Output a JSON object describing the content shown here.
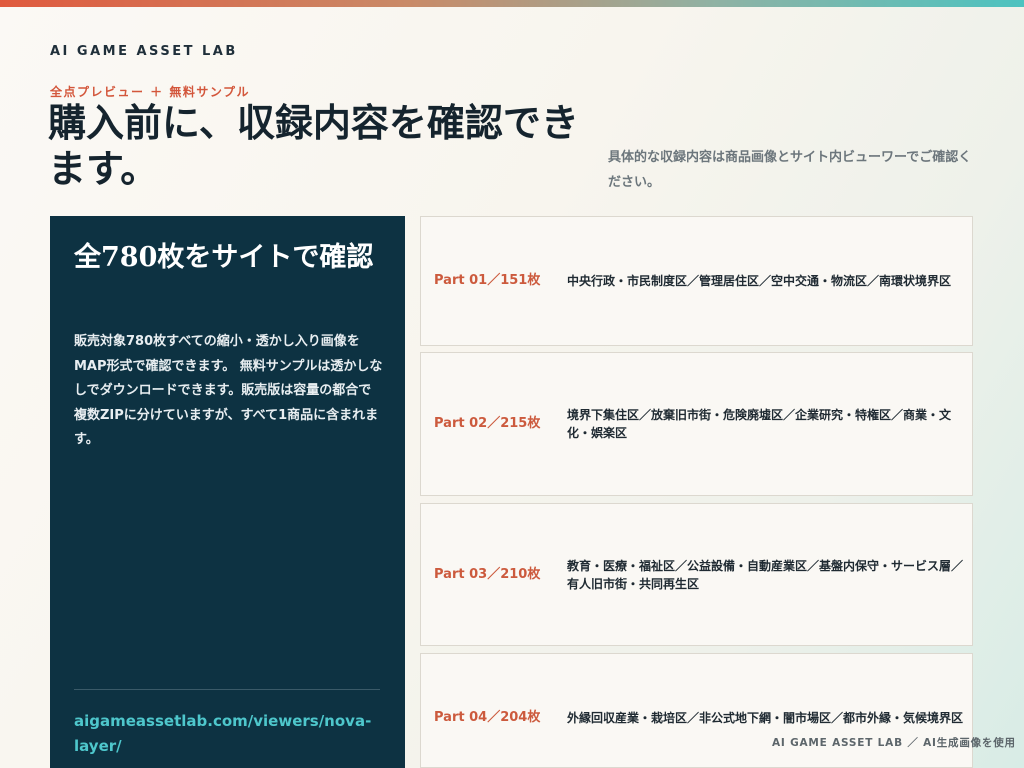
{
  "brand": "AI GAME ASSET LAB",
  "eyebrow": "全点プレビュー ＋ 無料サンプル",
  "headline": "購入前に、収録内容を確認できます。",
  "lead": "具体的な収録内容は商品画像とサイト内ビューワーでご確認ください。",
  "panel": {
    "title": "全780枚をサイトで確認",
    "body": "販売対象780枚すべての縮小・透かし入り画像をMAP形式で確認できます。 無料サンプルは透かしなしでダウンロードできます。販売版は容量の都合で複数ZIPに分けていますが、すべて1商品に含まれます。",
    "link": "aigameassetlab.com/viewers/nova-layer/"
  },
  "parts": [
    {
      "label": "Part 01／151枚",
      "desc": "中央行政・市民制度区／管理居住区／空中交通・物流区／南環状境界区"
    },
    {
      "label": "Part 02／215枚",
      "desc": "境界下集住区／放棄旧市街・危険廃墟区／企業研究・特権区／商業・文化・娯楽区"
    },
    {
      "label": "Part 03／210枚",
      "desc": "教育・医療・福祉区／公益設備・自動産業区／基盤内保守・サービス層／有人旧市街・共同再生区"
    },
    {
      "label": "Part 04／204枚",
      "desc": "外縁回収産業・栽培区／非公式地下網・闇市場区／都市外縁・気候境界区"
    }
  ],
  "footer": "AI GAME ASSET LAB ／ AI生成画像を使用",
  "colors": {
    "accent": "#d3563b",
    "panel_bg": "#0d3242",
    "link": "#4ec7cc"
  }
}
